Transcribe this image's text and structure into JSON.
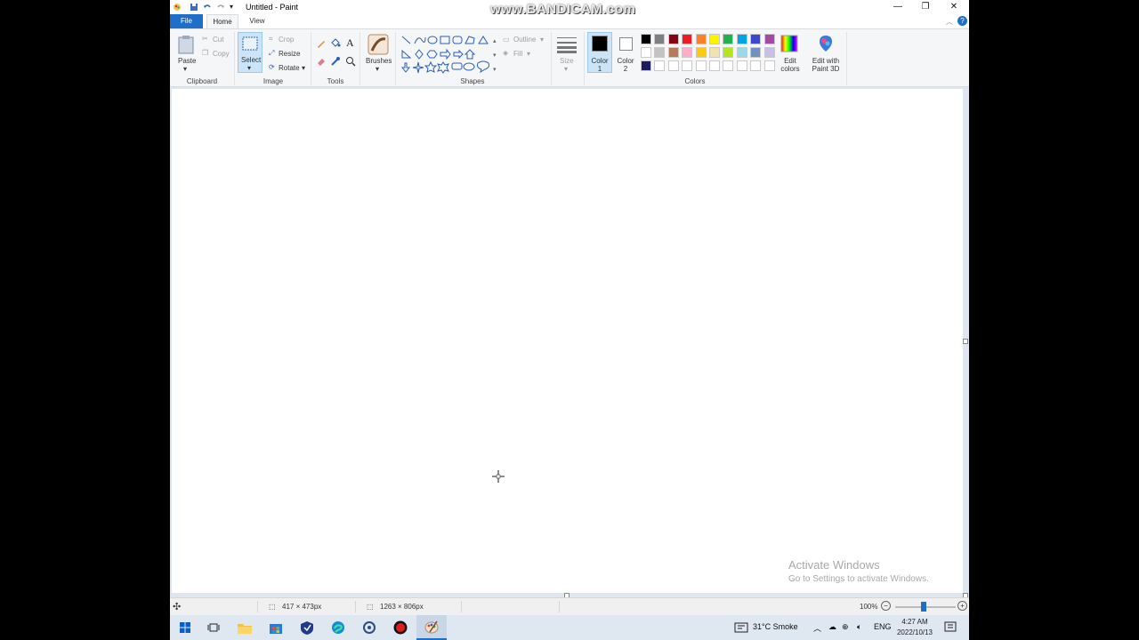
{
  "window": {
    "title": "Untitled - Paint",
    "watermark": "www.BANDICAM.com",
    "controls": {
      "minimize": "—",
      "restore": "❐",
      "close": "✕"
    }
  },
  "tabs": [
    "File",
    "Home",
    "View"
  ],
  "ribbon": {
    "clipboard": {
      "label": "Clipboard",
      "paste": "Paste",
      "cut": "Cut",
      "copy": "Copy"
    },
    "image": {
      "label": "Image",
      "select": "Select",
      "crop": "Crop",
      "resize": "Resize",
      "rotate": "Rotate"
    },
    "tools": {
      "label": "Tools"
    },
    "brushes": {
      "label": "Brushes"
    },
    "shapes": {
      "label": "Shapes",
      "outline": "Outline",
      "fill": "Fill"
    },
    "size": {
      "label": "Size"
    },
    "colors": {
      "label": "Colors",
      "color1": "Color 1",
      "color2": "Color 2",
      "edit_colors": "Edit colors",
      "edit_paint3d": "Edit with Paint 3D",
      "palette_row1": [
        "#000000",
        "#7f7f7f",
        "#880015",
        "#ed1c24",
        "#ff7f27",
        "#fff200",
        "#22b14c",
        "#00a2e8",
        "#3f48cc",
        "#a349a4"
      ],
      "palette_row2": [
        "#ffffff",
        "#c3c3c3",
        "#b97a57",
        "#ffaec9",
        "#ffc90e",
        "#efe4b0",
        "#b5e61d",
        "#99d9ea",
        "#7092be",
        "#c8bfe7"
      ],
      "palette_row3": [
        "#1c1c5c",
        "#ffffff",
        "#ffffff",
        "#ffffff",
        "#ffffff",
        "#ffffff",
        "#ffffff",
        "#ffffff",
        "#ffffff",
        "#ffffff"
      ]
    }
  },
  "watermark_activate": {
    "line1": "Activate Windows",
    "line2": "Go to Settings to activate Windows."
  },
  "status": {
    "selection": "417 × 473px",
    "canvas_size": "1263 × 806px",
    "zoom": "100%"
  },
  "taskbar": {
    "weather": "31°C  Smoke",
    "lang": "ENG",
    "time": "4:27 AM",
    "date": "2022/10/13"
  }
}
